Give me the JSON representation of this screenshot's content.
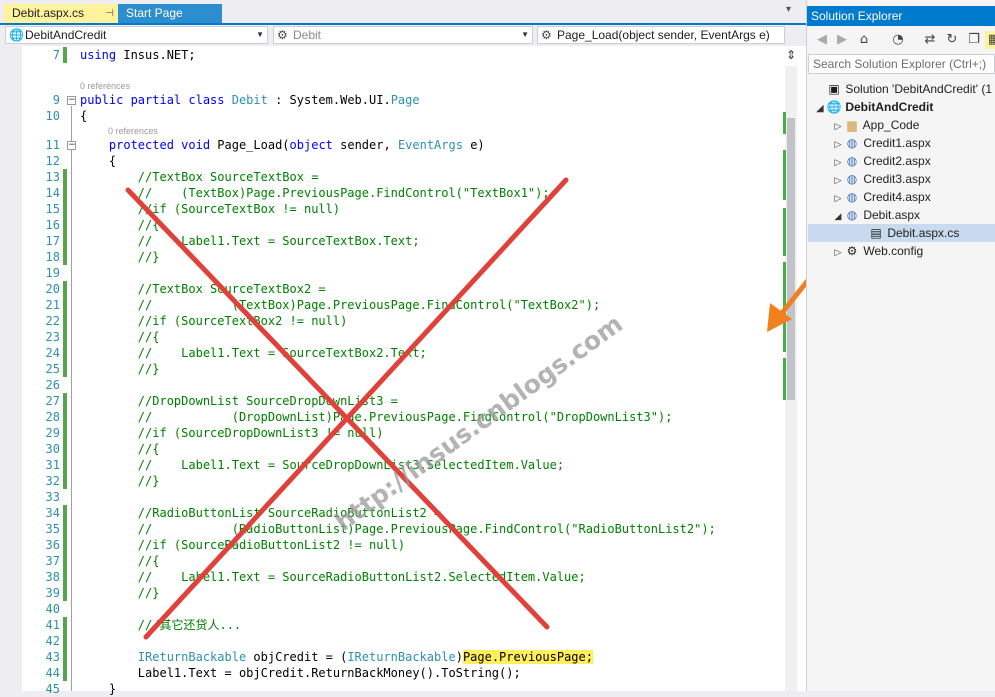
{
  "tabs": [
    {
      "label": "Debit.aspx.cs",
      "active": true
    },
    {
      "label": "Start Page",
      "active": false
    }
  ],
  "navbar": {
    "project": "DebitAndCredit",
    "class": "Debit",
    "member": "Page_Load(object sender, EventArgs e)"
  },
  "code": {
    "ref_label": "0 references",
    "lines": [
      {
        "n": "7",
        "text": "using Insus.NET;"
      },
      {
        "n": "9",
        "text": "public partial class Debit : System.Web.UI.Page"
      },
      {
        "n": "10",
        "text": "{"
      },
      {
        "n": "11",
        "text": "    protected void Page_Load(object sender, EventArgs e)"
      },
      {
        "n": "12",
        "text": "    {"
      },
      {
        "n": "13",
        "text": "        //TextBox SourceTextBox ="
      },
      {
        "n": "14",
        "text": "        //    (TextBox)Page.PreviousPage.FindControl(\"TextBox1\");"
      },
      {
        "n": "15",
        "text": "        //if (SourceTextBox != null)"
      },
      {
        "n": "16",
        "text": "        //{"
      },
      {
        "n": "17",
        "text": "        //    Label1.Text = SourceTextBox.Text;"
      },
      {
        "n": "18",
        "text": "        //}"
      },
      {
        "n": "19",
        "text": ""
      },
      {
        "n": "20",
        "text": "        //TextBox SourceTextBox2 ="
      },
      {
        "n": "21",
        "text": "        //           (TextBox)Page.PreviousPage.FindControl(\"TextBox2\");"
      },
      {
        "n": "22",
        "text": "        //if (SourceTextBox2 != null)"
      },
      {
        "n": "23",
        "text": "        //{"
      },
      {
        "n": "24",
        "text": "        //    Label1.Text = SourceTextBox2.Text;"
      },
      {
        "n": "25",
        "text": "        //}"
      },
      {
        "n": "26",
        "text": ""
      },
      {
        "n": "27",
        "text": "        //DropDownList SourceDropDownList3 ="
      },
      {
        "n": "28",
        "text": "        //           (DropDownList)Page.PreviousPage.FindControl(\"DropDownList3\");"
      },
      {
        "n": "29",
        "text": "        //if (SourceDropDownList3 != null)"
      },
      {
        "n": "30",
        "text": "        //{"
      },
      {
        "n": "31",
        "text": "        //    Label1.Text = SourceDropDownList3.SelectedItem.Value;"
      },
      {
        "n": "32",
        "text": "        //}"
      },
      {
        "n": "33",
        "text": ""
      },
      {
        "n": "34",
        "text": "        //RadioButtonList SourceRadioButtonList2 ="
      },
      {
        "n": "35",
        "text": "        //           (RadioButtonList)Page.PreviousPage.FindControl(\"RadioButtonList2\");"
      },
      {
        "n": "36",
        "text": "        //if (SourceRadioButtonList2 != null)"
      },
      {
        "n": "37",
        "text": "        //{"
      },
      {
        "n": "38",
        "text": "        //    Label1.Text = SourceRadioButtonList2.SelectedItem.Value;"
      },
      {
        "n": "39",
        "text": "        //}"
      },
      {
        "n": "40",
        "text": ""
      },
      {
        "n": "41",
        "text": "        ///其它还贷人..."
      },
      {
        "n": "42",
        "text": ""
      },
      {
        "n": "43",
        "text": "        IReturnBackable objCredit = (IReturnBackable)Page.PreviousPage;"
      },
      {
        "n": "44",
        "text": "        Label1.Text = objCredit.ReturnBackMoney().ToString();"
      },
      {
        "n": "45",
        "text": "    }"
      }
    ]
  },
  "watermark": "http://insus.cnblogs.com",
  "solution_explorer": {
    "title": "Solution Explorer",
    "search_placeholder": "Search Solution Explorer (Ctrl+;)",
    "nodes": [
      {
        "label": "Solution 'DebitAndCredit' (1 p",
        "icon": "solution-icon"
      },
      {
        "label": "DebitAndCredit",
        "icon": "web-project-icon"
      },
      {
        "label": "App_Code",
        "icon": "folder-icon"
      },
      {
        "label": "Credit1.aspx",
        "icon": "web-form-icon"
      },
      {
        "label": "Credit2.aspx",
        "icon": "web-form-icon"
      },
      {
        "label": "Credit3.aspx",
        "icon": "web-form-icon"
      },
      {
        "label": "Credit4.aspx",
        "icon": "web-form-icon"
      },
      {
        "label": "Debit.aspx",
        "icon": "web-form-icon"
      },
      {
        "label": "Debit.aspx.cs",
        "icon": "cs-file-icon"
      },
      {
        "label": "Web.config",
        "icon": "config-icon"
      }
    ]
  },
  "colors": {
    "accent": "#007acc",
    "active_tab": "#fff29d",
    "change_bar": "#57a64a",
    "cross": "#e0413b",
    "arrow": "#f0801e",
    "highlight": "#fff05a"
  }
}
